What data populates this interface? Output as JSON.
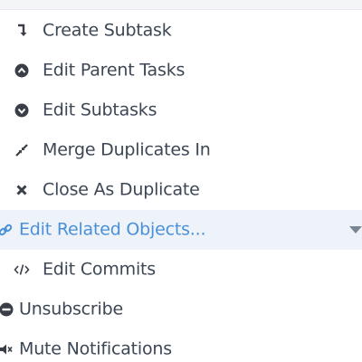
{
  "menu": {
    "items": [
      {
        "label": "Create Subtask",
        "icon": "subtask-arrow-icon"
      },
      {
        "label": "Edit Parent Tasks",
        "icon": "chevron-up-circle-icon"
      },
      {
        "label": "Edit Subtasks",
        "icon": "chevron-down-circle-icon"
      },
      {
        "label": "Merge Duplicates In",
        "icon": "compress-icon"
      },
      {
        "label": "Close As Duplicate",
        "icon": "close-icon"
      },
      {
        "label": "Edit Related Objects...",
        "icon": "link-icon"
      },
      {
        "label": "Edit Commits",
        "icon": "code-icon"
      },
      {
        "label": "Unsubscribe",
        "icon": "minus-circle-icon"
      },
      {
        "label": "Mute Notifications",
        "icon": "mute-speaker-icon"
      }
    ]
  },
  "colors": {
    "text": "#3c4655",
    "active_text": "#4a90d9",
    "active_background": "#eef3fa"
  }
}
